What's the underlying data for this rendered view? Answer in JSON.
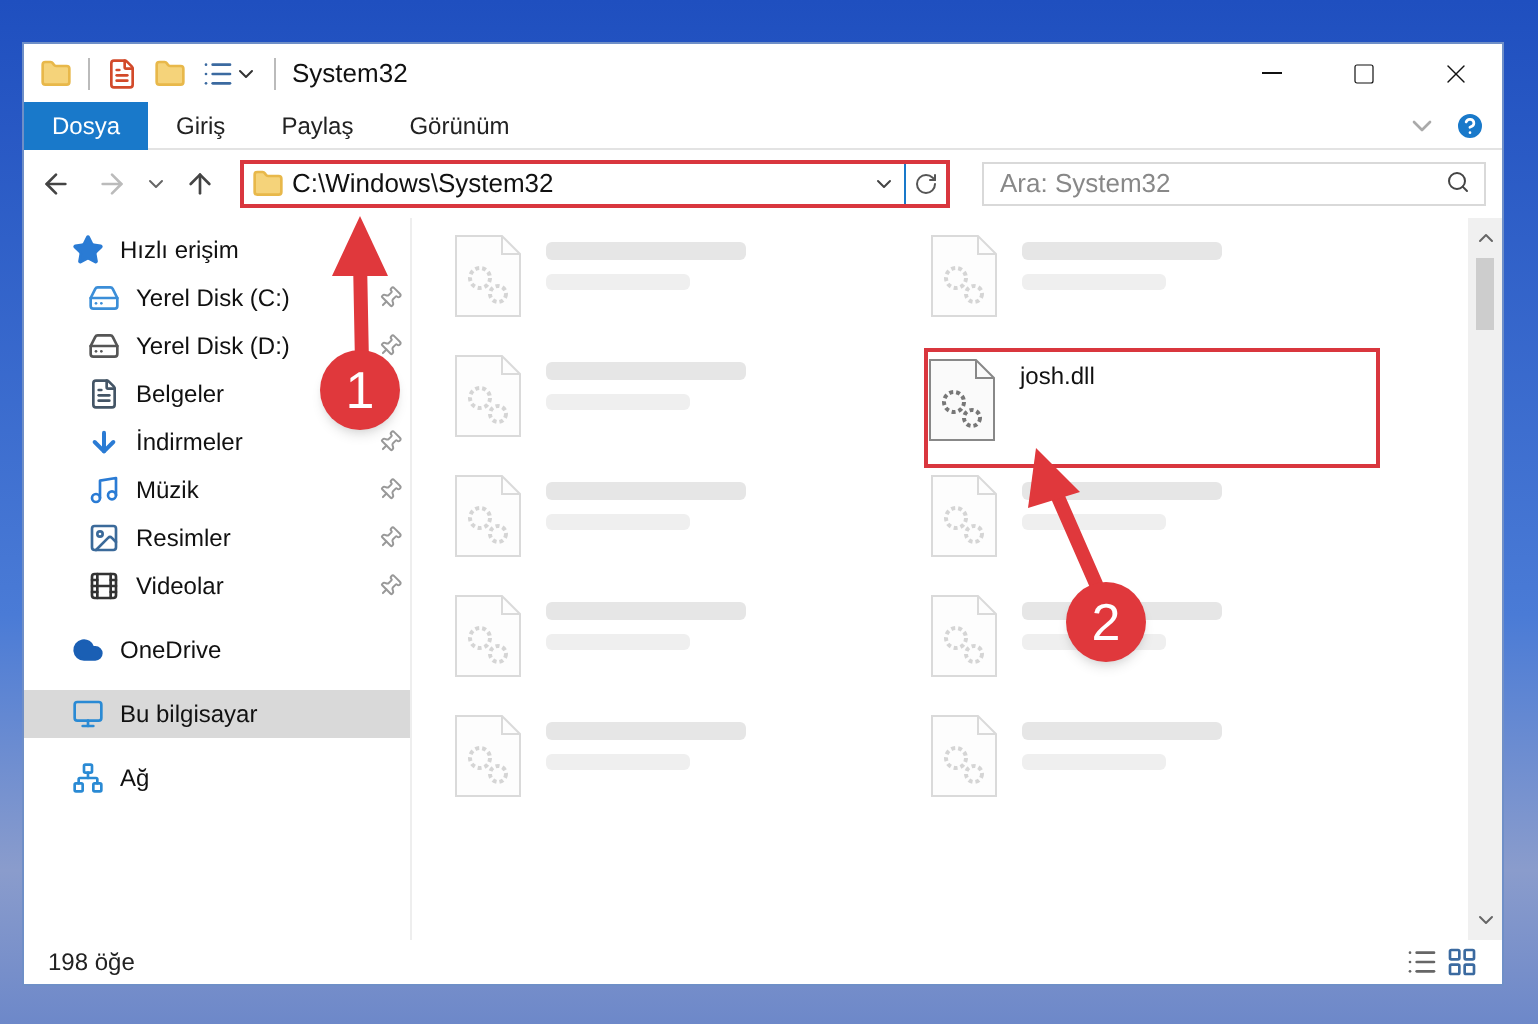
{
  "window": {
    "title": "System32"
  },
  "ribbon_tabs": [
    {
      "label": "Dosya",
      "selected": true
    },
    {
      "label": "Giriş",
      "selected": false
    },
    {
      "label": "Paylaş",
      "selected": false
    },
    {
      "label": "Görünüm",
      "selected": false
    }
  ],
  "address_bar": {
    "path": "C:\\Windows\\System32",
    "highlighted": true
  },
  "search": {
    "placeholder": "Ara: System32"
  },
  "sidebar": {
    "items": [
      {
        "label": "Hızlı erişim",
        "kind": "quick",
        "pinned": false,
        "selected": false,
        "children": [
          {
            "label": "Yerel Disk (C:)",
            "kind": "disk-c",
            "pinned": true,
            "selected": false
          },
          {
            "label": "Yerel Disk (D:)",
            "kind": "disk",
            "pinned": true,
            "selected": false
          },
          {
            "label": "Belgeler",
            "kind": "docs",
            "pinned": false,
            "selected": false
          },
          {
            "label": "İndirmeler",
            "kind": "downloads",
            "pinned": true,
            "selected": false
          },
          {
            "label": "Müzik",
            "kind": "music",
            "pinned": true,
            "selected": false
          },
          {
            "label": "Resimler",
            "kind": "pictures",
            "pinned": true,
            "selected": false
          },
          {
            "label": "Videolar",
            "kind": "videos",
            "pinned": true,
            "selected": false
          }
        ]
      },
      {
        "label": "OneDrive",
        "kind": "cloud",
        "pinned": false,
        "selected": false
      },
      {
        "label": "Bu bilgisayar",
        "kind": "pc",
        "pinned": false,
        "selected": true
      },
      {
        "label": "Ağ",
        "kind": "network",
        "pinned": false,
        "selected": false
      }
    ]
  },
  "files": [
    {
      "kind": "blurred"
    },
    {
      "kind": "blurred"
    },
    {
      "kind": "blurred"
    },
    {
      "kind": "file",
      "name": "josh.dll",
      "highlighted": true
    },
    {
      "kind": "blurred"
    },
    {
      "kind": "blurred"
    },
    {
      "kind": "blurred"
    },
    {
      "kind": "blurred"
    },
    {
      "kind": "blurred"
    },
    {
      "kind": "blurred"
    }
  ],
  "status_bar": {
    "count": "198 öğe"
  },
  "annotations": [
    {
      "number": "1"
    },
    {
      "number": "2"
    }
  ]
}
